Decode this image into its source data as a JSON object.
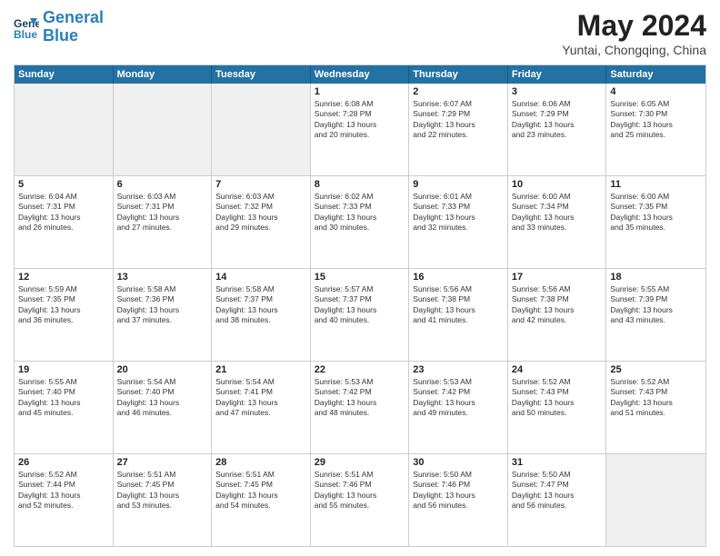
{
  "header": {
    "logo_line1": "General",
    "logo_line2": "Blue",
    "main_title": "May 2024",
    "subtitle": "Yuntai, Chongqing, China"
  },
  "days_of_week": [
    "Sunday",
    "Monday",
    "Tuesday",
    "Wednesday",
    "Thursday",
    "Friday",
    "Saturday"
  ],
  "weeks": [
    [
      {
        "day": "",
        "detail": "",
        "shaded": true
      },
      {
        "day": "",
        "detail": "",
        "shaded": true
      },
      {
        "day": "",
        "detail": "",
        "shaded": true
      },
      {
        "day": "1",
        "detail": "Sunrise: 6:08 AM\nSunset: 7:28 PM\nDaylight: 13 hours\nand 20 minutes.",
        "shaded": false
      },
      {
        "day": "2",
        "detail": "Sunrise: 6:07 AM\nSunset: 7:29 PM\nDaylight: 13 hours\nand 22 minutes.",
        "shaded": false
      },
      {
        "day": "3",
        "detail": "Sunrise: 6:06 AM\nSunset: 7:29 PM\nDaylight: 13 hours\nand 23 minutes.",
        "shaded": false
      },
      {
        "day": "4",
        "detail": "Sunrise: 6:05 AM\nSunset: 7:30 PM\nDaylight: 13 hours\nand 25 minutes.",
        "shaded": false
      }
    ],
    [
      {
        "day": "5",
        "detail": "Sunrise: 6:04 AM\nSunset: 7:31 PM\nDaylight: 13 hours\nand 26 minutes.",
        "shaded": false
      },
      {
        "day": "6",
        "detail": "Sunrise: 6:03 AM\nSunset: 7:31 PM\nDaylight: 13 hours\nand 27 minutes.",
        "shaded": false
      },
      {
        "day": "7",
        "detail": "Sunrise: 6:03 AM\nSunset: 7:32 PM\nDaylight: 13 hours\nand 29 minutes.",
        "shaded": false
      },
      {
        "day": "8",
        "detail": "Sunrise: 6:02 AM\nSunset: 7:33 PM\nDaylight: 13 hours\nand 30 minutes.",
        "shaded": false
      },
      {
        "day": "9",
        "detail": "Sunrise: 6:01 AM\nSunset: 7:33 PM\nDaylight: 13 hours\nand 32 minutes.",
        "shaded": false
      },
      {
        "day": "10",
        "detail": "Sunrise: 6:00 AM\nSunset: 7:34 PM\nDaylight: 13 hours\nand 33 minutes.",
        "shaded": false
      },
      {
        "day": "11",
        "detail": "Sunrise: 6:00 AM\nSunset: 7:35 PM\nDaylight: 13 hours\nand 35 minutes.",
        "shaded": false
      }
    ],
    [
      {
        "day": "12",
        "detail": "Sunrise: 5:59 AM\nSunset: 7:35 PM\nDaylight: 13 hours\nand 36 minutes.",
        "shaded": false
      },
      {
        "day": "13",
        "detail": "Sunrise: 5:58 AM\nSunset: 7:36 PM\nDaylight: 13 hours\nand 37 minutes.",
        "shaded": false
      },
      {
        "day": "14",
        "detail": "Sunrise: 5:58 AM\nSunset: 7:37 PM\nDaylight: 13 hours\nand 38 minutes.",
        "shaded": false
      },
      {
        "day": "15",
        "detail": "Sunrise: 5:57 AM\nSunset: 7:37 PM\nDaylight: 13 hours\nand 40 minutes.",
        "shaded": false
      },
      {
        "day": "16",
        "detail": "Sunrise: 5:56 AM\nSunset: 7:38 PM\nDaylight: 13 hours\nand 41 minutes.",
        "shaded": false
      },
      {
        "day": "17",
        "detail": "Sunrise: 5:56 AM\nSunset: 7:38 PM\nDaylight: 13 hours\nand 42 minutes.",
        "shaded": false
      },
      {
        "day": "18",
        "detail": "Sunrise: 5:55 AM\nSunset: 7:39 PM\nDaylight: 13 hours\nand 43 minutes.",
        "shaded": false
      }
    ],
    [
      {
        "day": "19",
        "detail": "Sunrise: 5:55 AM\nSunset: 7:40 PM\nDaylight: 13 hours\nand 45 minutes.",
        "shaded": false
      },
      {
        "day": "20",
        "detail": "Sunrise: 5:54 AM\nSunset: 7:40 PM\nDaylight: 13 hours\nand 46 minutes.",
        "shaded": false
      },
      {
        "day": "21",
        "detail": "Sunrise: 5:54 AM\nSunset: 7:41 PM\nDaylight: 13 hours\nand 47 minutes.",
        "shaded": false
      },
      {
        "day": "22",
        "detail": "Sunrise: 5:53 AM\nSunset: 7:42 PM\nDaylight: 13 hours\nand 48 minutes.",
        "shaded": false
      },
      {
        "day": "23",
        "detail": "Sunrise: 5:53 AM\nSunset: 7:42 PM\nDaylight: 13 hours\nand 49 minutes.",
        "shaded": false
      },
      {
        "day": "24",
        "detail": "Sunrise: 5:52 AM\nSunset: 7:43 PM\nDaylight: 13 hours\nand 50 minutes.",
        "shaded": false
      },
      {
        "day": "25",
        "detail": "Sunrise: 5:52 AM\nSunset: 7:43 PM\nDaylight: 13 hours\nand 51 minutes.",
        "shaded": false
      }
    ],
    [
      {
        "day": "26",
        "detail": "Sunrise: 5:52 AM\nSunset: 7:44 PM\nDaylight: 13 hours\nand 52 minutes.",
        "shaded": false
      },
      {
        "day": "27",
        "detail": "Sunrise: 5:51 AM\nSunset: 7:45 PM\nDaylight: 13 hours\nand 53 minutes.",
        "shaded": false
      },
      {
        "day": "28",
        "detail": "Sunrise: 5:51 AM\nSunset: 7:45 PM\nDaylight: 13 hours\nand 54 minutes.",
        "shaded": false
      },
      {
        "day": "29",
        "detail": "Sunrise: 5:51 AM\nSunset: 7:46 PM\nDaylight: 13 hours\nand 55 minutes.",
        "shaded": false
      },
      {
        "day": "30",
        "detail": "Sunrise: 5:50 AM\nSunset: 7:46 PM\nDaylight: 13 hours\nand 56 minutes.",
        "shaded": false
      },
      {
        "day": "31",
        "detail": "Sunrise: 5:50 AM\nSunset: 7:47 PM\nDaylight: 13 hours\nand 56 minutes.",
        "shaded": false
      },
      {
        "day": "",
        "detail": "",
        "shaded": true
      }
    ]
  ]
}
